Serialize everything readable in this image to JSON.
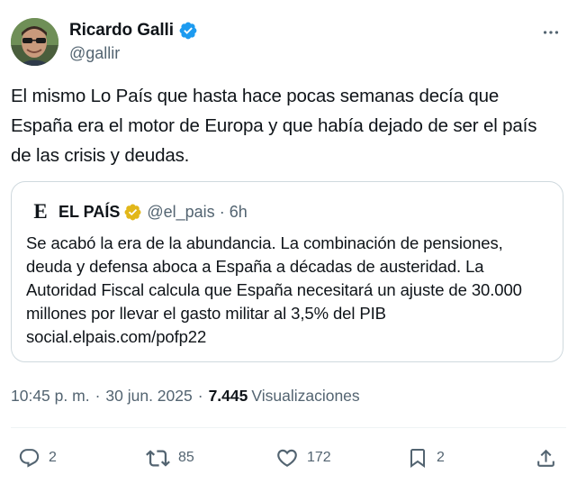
{
  "author": {
    "display_name": "Ricardo Galli",
    "handle": "@gallir",
    "verified": true,
    "avatar_icon": "profile-photo"
  },
  "tweet": {
    "text": "El mismo Lo País que hasta hace pocas semanas decía que España era el motor de Europa y que había dejado de ser el país de las crisis y deudas."
  },
  "quoted_tweet": {
    "logo": "E",
    "display_name": "EL PAÍS",
    "handle": "@el_pais",
    "separator": "·",
    "time": "6h",
    "text": "Se acabó la era de la abundancia. La combinación de pensiones, deuda y defensa aboca a España a décadas de austeridad. La Autoridad Fiscal calcula que España necesitará un ajuste de 30.000 millones por llevar el gasto militar al 3,5% del PIB social.elpais.com/pofp22"
  },
  "meta": {
    "time": "10:45 p. m.",
    "separator": "·",
    "date": "30 jun. 2025",
    "separator2": "·",
    "views_count": "7.445",
    "views_label": "Visualizaciones"
  },
  "actions": {
    "replies": "2",
    "reposts": "85",
    "likes": "172",
    "bookmarks": "2"
  },
  "colors": {
    "text_primary": "#0f1419",
    "text_secondary": "#536471",
    "verified_blue": "#1d9bf0",
    "verified_gold": "#e2b719",
    "border": "#cfd9de"
  },
  "icons": {
    "more": "more-horizontal-icon",
    "reply": "reply-icon",
    "repost": "repost-icon",
    "like": "heart-icon",
    "bookmark": "bookmark-icon",
    "share": "share-icon"
  }
}
